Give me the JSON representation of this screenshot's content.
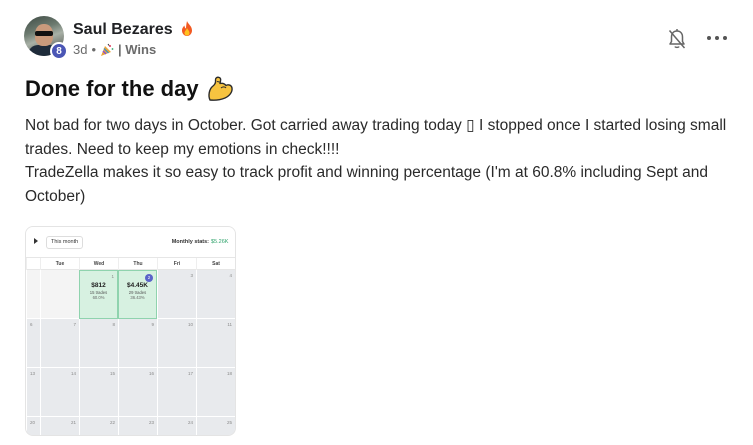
{
  "post": {
    "author": {
      "name": "Saul Bezares",
      "level": "8",
      "avatar_icon": "avatar-photo",
      "flair_icon": "fire-icon"
    },
    "meta": {
      "time": "3d",
      "separator": "•",
      "category_icon": "party-popper-icon",
      "category": "| Wins"
    },
    "title": "Done for the day",
    "title_icon": "flexed-biceps-icon",
    "body": [
      "Not bad for two days in October. Got carried away trading today ▯ I stopped once I started losing small trades. Need to keep my emotions in check!!!!",
      "TradeZella makes it so easy to track profit and winning percentage (I'm at 60.8% including Sept and October)"
    ]
  },
  "actions": {
    "notify_icon": "bell-off-icon",
    "more_icon": "more-horizontal-icon"
  },
  "attachment": {
    "range_label": "This month",
    "stats_label": "Monthly stats:",
    "stats_value": "$5.26K",
    "weekdays": [
      "Tue",
      "Wed",
      "Thu",
      "Fri",
      "Sat"
    ],
    "rows": [
      [
        {
          "day": "",
          "empty": true
        },
        {
          "day": "",
          "empty": true
        },
        {
          "day": "1",
          "win": true,
          "pnl": "$812",
          "trades": "15 trades",
          "rate": "60.0%"
        },
        {
          "day": "2",
          "win": true,
          "today": true,
          "pnl": "$4.45K",
          "trades": "29 trades",
          "rate": "36.43%"
        },
        {
          "day": "3"
        },
        {
          "day": "4"
        }
      ],
      [
        {
          "day": "6"
        },
        {
          "day": "7"
        },
        {
          "day": "8"
        },
        {
          "day": "9"
        },
        {
          "day": "10"
        },
        {
          "day": "11"
        }
      ],
      [
        {
          "day": "13"
        },
        {
          "day": "14"
        },
        {
          "day": "15"
        },
        {
          "day": "16"
        },
        {
          "day": "17"
        },
        {
          "day": "18"
        }
      ],
      [
        {
          "day": "20"
        },
        {
          "day": "21"
        },
        {
          "day": "22"
        },
        {
          "day": "23"
        },
        {
          "day": "24"
        },
        {
          "day": "25"
        }
      ]
    ],
    "colors": {
      "win_fill": "#d7f1e1",
      "win_border": "#8fd3ae",
      "accent": "#4b56b5",
      "stats_green": "#2fa36b"
    }
  }
}
